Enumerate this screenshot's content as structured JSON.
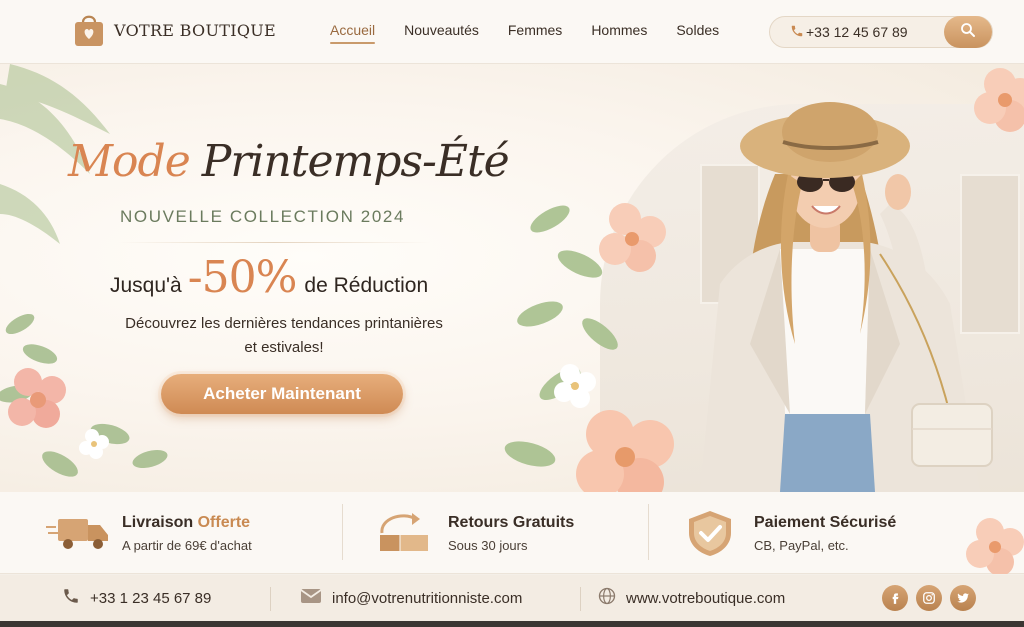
{
  "brand": {
    "name": "VOTRE BOUTIQUE"
  },
  "nav": {
    "items": [
      {
        "label": "Accueil",
        "active": true
      },
      {
        "label": "Nouveautés"
      },
      {
        "label": "Femmes"
      },
      {
        "label": "Hommes"
      },
      {
        "label": "Soldes"
      }
    ],
    "phone": "+33 12 45 67 89"
  },
  "hero": {
    "title_part1": "Mode",
    "title_part2": "Printemps-Été",
    "subtitle": "NOUVELLE COLLECTION 2024",
    "discount_pre": "Jusqu'à",
    "discount_value": "-50%",
    "discount_post": "de Réduction",
    "description_line1": "Découvrez les dernières tendances printanières",
    "description_line2": "et estivales!",
    "cta_label": "Acheter Maintenant"
  },
  "features": [
    {
      "title_part1": "Livraison",
      "title_part2": "Offerte",
      "subtitle": "A partir de 69€ d'achat",
      "icon": "delivery-truck-icon"
    },
    {
      "title": "Retours Gratuits",
      "subtitle": "Sous 30 jours",
      "icon": "return-box-icon"
    },
    {
      "title": "Paiement Sécurisé",
      "subtitle": "CB, PayPal, etc.",
      "icon": "shield-check-icon"
    }
  ],
  "footer": {
    "phone": "+33 1 23 45 67 89",
    "email": "info@votrenutritionniste.com",
    "website": "www.votreboutique.com",
    "social": [
      "facebook-icon",
      "instagram-icon",
      "twitter-icon"
    ]
  },
  "colors": {
    "accent": "#d98552",
    "cta": "#cf8a54",
    "sage": "#6b7b5e",
    "text": "#3a2e26"
  }
}
